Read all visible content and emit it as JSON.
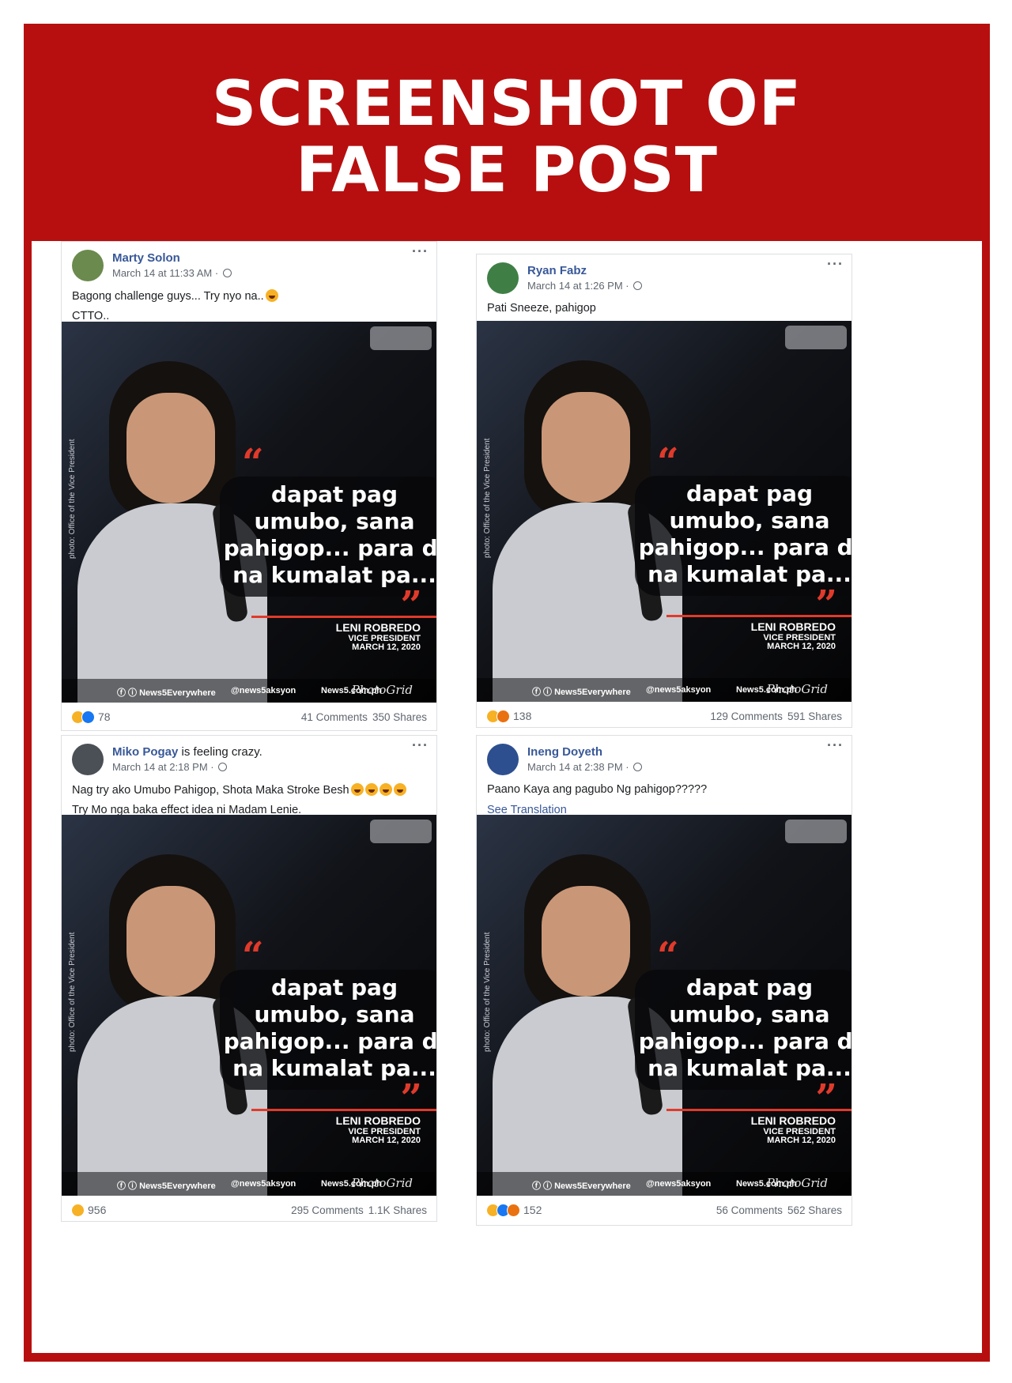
{
  "banner": {
    "line1": "SCREENSHOT OF",
    "line2": "FALSE POST"
  },
  "image_overlay": {
    "side_credit": "photo: Office of the Vice President",
    "quote": "dapat pag umubo, sana pahigop... para di na kumalat pa...",
    "quote_open": "“",
    "quote_close": "”",
    "source_name": "LENI ROBREDO",
    "source_role": "VICE PRESIDENT",
    "source_date": "MARCH 12, 2020",
    "footer_facebook": "ⓕ ⓘ News5Everywhere",
    "footer_twitter": "@news5aksyon",
    "footer_web": "News5.com.ph",
    "footer_watermark": "PhotoGrid"
  },
  "posts": [
    {
      "author": "Marty Solon",
      "feeling": "",
      "time": "March 14 at 11:33 AM ·",
      "text1": "Bagong challenge guys... Try nyo na..",
      "text2": "CTTO..",
      "text2_link": false,
      "reactions": [
        "haha",
        "like"
      ],
      "reaction_count": "78",
      "comments": "41 Comments",
      "shares": "350 Shares"
    },
    {
      "author": "Ryan Fabz",
      "feeling": "",
      "time": "March 14 at 1:26 PM ·",
      "text1": "Pati Sneeze, pahigop",
      "text2": "",
      "text2_link": false,
      "reactions": [
        "haha",
        "angry"
      ],
      "reaction_count": "138",
      "comments": "129 Comments",
      "shares": "591 Shares"
    },
    {
      "author": "Miko Pogay",
      "feeling": " is  feeling crazy.",
      "time": "March 14 at 2:18 PM ·",
      "text1": "Nag try ako Umubo Pahigop, Shota Maka Stroke Besh",
      "text2": "Try Mo nga baka effect idea ni Madam Lenie.",
      "text2_link": false,
      "reactions": [
        "haha"
      ],
      "reaction_count": "956",
      "comments": "295 Comments",
      "shares": "1.1K Shares"
    },
    {
      "author": "Ineng Doyeth",
      "feeling": "",
      "time": "March 14 at 2:38 PM ·",
      "text1": "Paano Kaya ang pagubo Ng pahigop?????",
      "text2": "See Translation",
      "text2_link": true,
      "reactions": [
        "haha",
        "like",
        "angry"
      ],
      "reaction_count": "152",
      "comments": "56 Comments",
      "shares": "562 Shares"
    }
  ],
  "colors": {
    "banner_red": "#b70f0f",
    "link_blue": "#385898",
    "quote_red": "#e03a2b"
  }
}
